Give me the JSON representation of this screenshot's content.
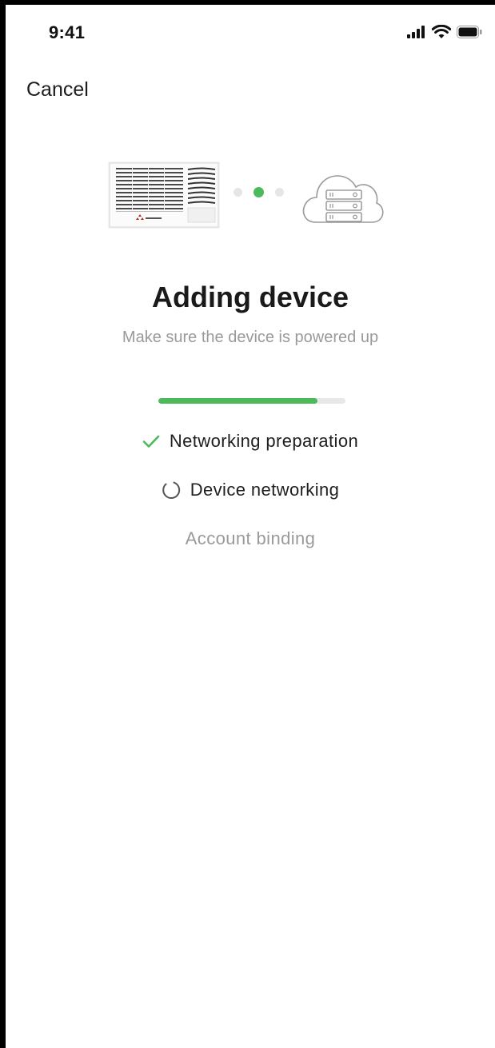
{
  "status_bar": {
    "time": "9:41",
    "icons": [
      "signal-icon",
      "wifi-icon",
      "battery-icon"
    ]
  },
  "nav": {
    "cancel_label": "Cancel"
  },
  "illustration": {
    "device": "air-conditioner-image",
    "cloud": "cloud-server-icon",
    "active_dot": 2,
    "dot_colors": {
      "inactive": "#e6e6e6",
      "active": "#4cba5a"
    }
  },
  "main": {
    "title": "Adding device",
    "subtitle": "Make sure the device is powered up",
    "progress": 0.85
  },
  "steps": [
    {
      "label": "Networking preparation",
      "status": "done",
      "icon": "checkmark-icon"
    },
    {
      "label": "Device networking",
      "status": "in-progress",
      "icon": "loading-spinner-icon"
    },
    {
      "label": "Account binding",
      "status": "pending"
    }
  ],
  "colors": {
    "accent": "#4cba5a",
    "text_primary": "#1a1a1a",
    "text_secondary": "#9a9a9a",
    "track": "#e8e8e8"
  }
}
